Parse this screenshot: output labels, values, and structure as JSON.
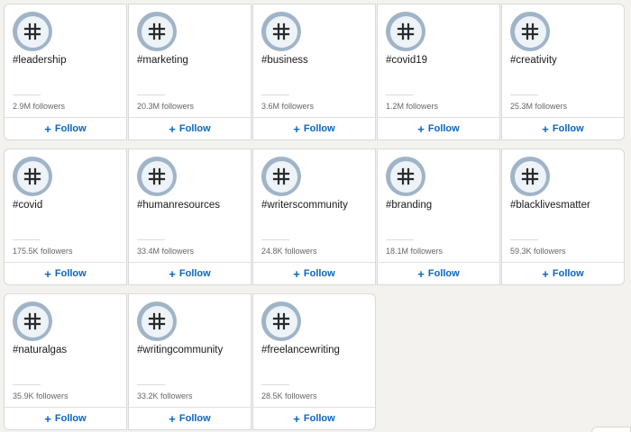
{
  "follow_label": "Follow",
  "hashtags": [
    {
      "name": "#leadership",
      "followers": "2.9M followers"
    },
    {
      "name": "#marketing",
      "followers": "20.3M followers"
    },
    {
      "name": "#business",
      "followers": "3.6M followers"
    },
    {
      "name": "#covid19",
      "followers": "1.2M followers"
    },
    {
      "name": "#creativity",
      "followers": "25.3M followers"
    },
    {
      "name": "#covid",
      "followers": "175.5K followers"
    },
    {
      "name": "#humanresources",
      "followers": "33.4M followers"
    },
    {
      "name": "#writerscommunity",
      "followers": "24.8K followers"
    },
    {
      "name": "#branding",
      "followers": "18.1M followers"
    },
    {
      "name": "#blacklivesmatter",
      "followers": "59.3K followers"
    },
    {
      "name": "#naturalgas",
      "followers": "35.9K followers"
    },
    {
      "name": "#writingcommunity",
      "followers": "33.2K followers"
    },
    {
      "name": "#freelancewriting",
      "followers": "28.5K followers"
    }
  ],
  "icons": {
    "hashtag": "hashtag-icon",
    "plus": "plus-icon"
  },
  "colors": {
    "accent": "#0a66c2",
    "icon_ring": "#a0b4c8",
    "icon_fill": "#eef3f8"
  }
}
